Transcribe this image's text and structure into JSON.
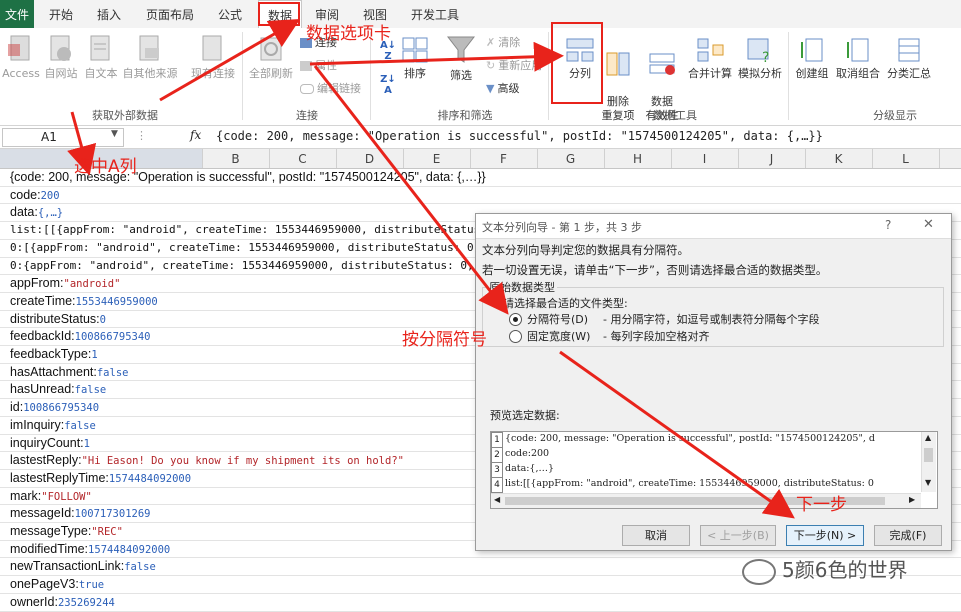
{
  "tabs": [
    "文件",
    "开始",
    "插入",
    "页面布局",
    "公式",
    "数据",
    "审阅",
    "视图",
    "开发工具"
  ],
  "ribbon": {
    "get_external": [
      "Access",
      "自网站",
      "自文本",
      "自其他来源",
      "现有连接"
    ],
    "get_external_label": "获取外部数据",
    "refresh_all": "全部刷新",
    "connections": [
      "连接",
      "属性",
      "编辑链接"
    ],
    "connections_label": "连接",
    "sort_filter": [
      "排序",
      "筛选",
      "清除",
      "重新应用",
      "高级"
    ],
    "sort_filter_label": "排序和筛选",
    "data_tools": [
      "分列",
      "删除\n重复项",
      "数据\n有效性",
      "合并计算",
      "模拟分析"
    ],
    "data_tools_label": "数据工具",
    "outline": [
      "创建组",
      "取消组合",
      "分类汇总"
    ],
    "outline_label": "分级显示"
  },
  "formula_bar": {
    "name_box": "A1",
    "fx": "fx",
    "content": "{code: 200, message: \"Operation is successful\", postId: \"1574500124205\", data: {,…}}"
  },
  "columns": [
    "B",
    "C",
    "D",
    "E",
    "F",
    "G",
    "H",
    "I",
    "J",
    "K",
    "L"
  ],
  "rows": [
    {
      "k": "{code: 200, message: \"Operation is successful\", postId: \"1574500124205\", data: {,…}}",
      "v": "",
      "t": "plain"
    },
    {
      "k": "code:",
      "v": "200",
      "t": "num"
    },
    {
      "k": "data:",
      "v": "{,…}",
      "t": "num"
    },
    {
      "k": "list:[[{appFrom: \"android\", createTime: 1553446959000, distributeStatus: 0,",
      "v": "",
      "t": "mono"
    },
    {
      "k": "0:[{appFrom: \"android\", createTime: 1553446959000, distributeStatus: 0,",
      "v": "",
      "t": "mono"
    },
    {
      "k": "0:{appFrom: \"android\", createTime: 1553446959000, distributeStatus: 0,",
      "v": "",
      "t": "mono"
    },
    {
      "k": "appFrom:",
      "v": "\"android\"",
      "t": "str"
    },
    {
      "k": "createTime:",
      "v": "1553446959000",
      "t": "num"
    },
    {
      "k": "distributeStatus:",
      "v": "0",
      "t": "num"
    },
    {
      "k": "feedbackId:",
      "v": "100866795340",
      "t": "num"
    },
    {
      "k": "feedbackType:",
      "v": "1",
      "t": "num"
    },
    {
      "k": "hasAttachment:",
      "v": "false",
      "t": "num"
    },
    {
      "k": "hasUnread:",
      "v": "false",
      "t": "num"
    },
    {
      "k": "id:",
      "v": "100866795340",
      "t": "num"
    },
    {
      "k": "imInquiry:",
      "v": "false",
      "t": "num"
    },
    {
      "k": "inquiryCount:",
      "v": "1",
      "t": "num"
    },
    {
      "k": "lastestReply:",
      "v": "\"Hi Eason! Do you know if my shipment its on hold?\"",
      "t": "str"
    },
    {
      "k": "lastestReplyTime:",
      "v": "1574484092000",
      "t": "num"
    },
    {
      "k": "mark:",
      "v": "\"FOLLOW\"",
      "t": "str"
    },
    {
      "k": "messageId:",
      "v": "100717301269",
      "t": "num"
    },
    {
      "k": "messageType:",
      "v": "\"REC\"",
      "t": "str"
    },
    {
      "k": "modifiedTime:",
      "v": "1574484092000",
      "t": "num"
    },
    {
      "k": "newTransactionLink:",
      "v": "false",
      "t": "num"
    },
    {
      "k": "onePageV3:",
      "v": "true",
      "t": "num"
    },
    {
      "k": "ownerId:",
      "v": "235269244",
      "t": "num"
    }
  ],
  "dialog": {
    "title": "文本分列向导 - 第 1 步，共 3 步",
    "help": "?",
    "close": "✕",
    "line1": "文本分列向导判定您的数据具有分隔符。",
    "line2": "若一切设置无误，请单击“下一步”，否则请选择最合适的数据类型。",
    "group_title": "原始数据类型",
    "group_prompt": "请选择最合适的文件类型:",
    "opt1": "分隔符号(D)",
    "opt1_desc": "- 用分隔字符，如逗号或制表符分隔每个字段",
    "opt2": "固定宽度(W)",
    "opt2_desc": "- 每列字段加空格对齐",
    "preview_label": "预览选定数据:",
    "preview": [
      "{code: 200, message: \"Operation is successful\", postId: \"1574500124205\", d",
      "code:200",
      "data:{,…}",
      "list:[[{appFrom: \"android\", createTime: 1553446959000, distributeStatus: 0"
    ],
    "cancel": "取消",
    "back": "< 上一步(B)",
    "next": "下一步(N) >",
    "finish": "完成(F)"
  },
  "annotations": {
    "data_tab": "数据选项卡",
    "select_col": "选中A列",
    "delimiter": "按分隔符号",
    "next": "下一步"
  },
  "watermark": "5颜6色的世界",
  "colors": {
    "excel_green": "#1e7145",
    "annotation_red": "#e8231b",
    "value_blue": "#2b5fb8",
    "string_red": "#b3262a"
  }
}
